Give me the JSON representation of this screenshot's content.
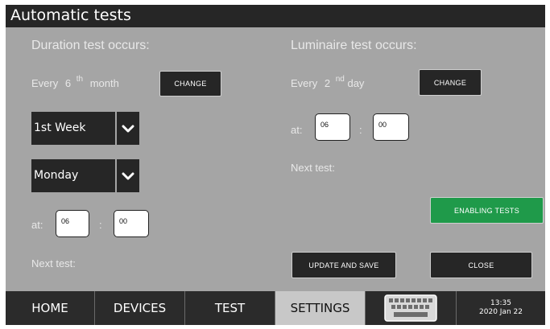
{
  "window": {
    "title": "Automatic tests"
  },
  "duration": {
    "heading": "Duration test occurs:",
    "every_label": "Every",
    "every_value": "6",
    "every_suffix": "th",
    "every_unit": "month",
    "change_label": "CHANGE",
    "week_select": "1st Week",
    "day_select": "Monday",
    "at_label": "at:",
    "hour": "06",
    "separator": ":",
    "minute": "00",
    "next_test_label": "Next test:"
  },
  "luminaire": {
    "heading": "Luminaire test occurs:",
    "every_label": "Every",
    "every_value": "2",
    "every_suffix": "nd",
    "every_unit": "day",
    "change_label": "CHANGE",
    "at_label": "at:",
    "hour": "06",
    "separator": ":",
    "minute": "00",
    "next_test_label": "Next test:"
  },
  "actions": {
    "enabling_label": "ENABLING TESTS",
    "update_label": "UPDATE AND SAVE",
    "close_label": "CLOSE"
  },
  "nav": {
    "tabs": [
      "HOME",
      "DEVICES",
      "TEST",
      "SETTINGS"
    ],
    "active_tab": "SETTINGS",
    "keyboard_icon": "keyboard-icon",
    "time": "13:35",
    "date": "2020 Jan 22"
  },
  "colors": {
    "background": "#a5a5a5",
    "bar": "#262626",
    "accent_green": "#1f9a4a",
    "active_tab": "#c8c8c8"
  }
}
